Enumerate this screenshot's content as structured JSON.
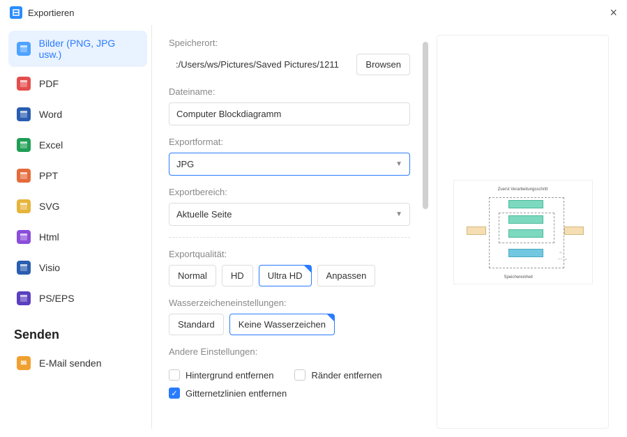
{
  "titlebar": {
    "title": "Exportieren"
  },
  "sidebar": {
    "items": [
      {
        "label": "Bilder (PNG, JPG usw.)",
        "selected": true,
        "color": "#4da3ff"
      },
      {
        "label": "PDF",
        "selected": false,
        "color": "#e44d4d"
      },
      {
        "label": "Word",
        "selected": false,
        "color": "#2a5db0"
      },
      {
        "label": "Excel",
        "selected": false,
        "color": "#1f9e55"
      },
      {
        "label": "PPT",
        "selected": false,
        "color": "#e46b3c"
      },
      {
        "label": "SVG",
        "selected": false,
        "color": "#e6b43c"
      },
      {
        "label": "Html",
        "selected": false,
        "color": "#8a4dd9"
      },
      {
        "label": "Visio",
        "selected": false,
        "color": "#2a5db0"
      },
      {
        "label": "PS/EPS",
        "selected": false,
        "color": "#5a3fbf"
      }
    ],
    "send_heading": "Senden",
    "email": {
      "label": "E-Mail senden",
      "color": "#f0a030"
    }
  },
  "form": {
    "location_label": "Speicherort:",
    "location_path": ":/Users/ws/Pictures/Saved Pictures/1211",
    "browse_btn": "Browsen",
    "filename_label": "Dateiname:",
    "filename_value": "Computer Blockdiagramm",
    "format_label": "Exportformat:",
    "format_value": "JPG",
    "range_label": "Exportbereich:",
    "range_value": "Aktuelle Seite",
    "quality_label": "Exportqualität:",
    "quality_options": [
      "Normal",
      "HD",
      "Ultra HD",
      "Anpassen"
    ],
    "quality_selected": 2,
    "watermark_label": "Wasserzeicheneinstellungen:",
    "watermark_options": [
      "Standard",
      "Keine Wasserzeichen"
    ],
    "watermark_selected": 1,
    "other_label": "Andere Einstellungen:",
    "checks": {
      "remove_bg": "Hintergrund entfernen",
      "remove_margins": "Ränder entfernen",
      "remove_grid": "Gitternetzlinien entfernen"
    }
  }
}
